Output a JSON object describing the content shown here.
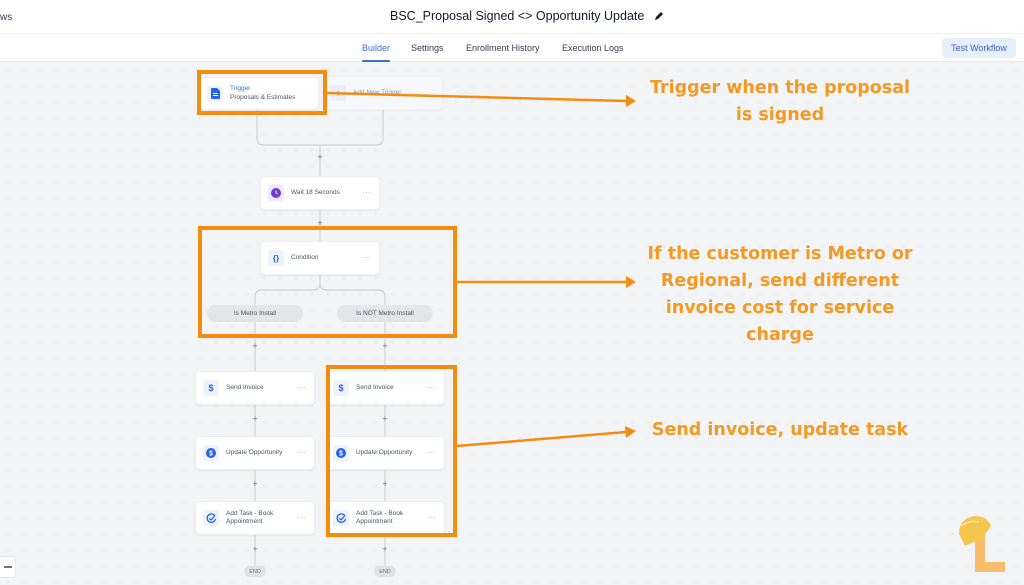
{
  "header": {
    "back_label": "ws",
    "title": "BSC_Proposal Signed <> Opportunity Update",
    "edit_icon": "pencil-icon"
  },
  "tabs": [
    {
      "label": "Builder",
      "active": true
    },
    {
      "label": "Settings",
      "active": false
    },
    {
      "label": "Enrollment History",
      "active": false
    },
    {
      "label": "Execution Logs",
      "active": false
    }
  ],
  "test_button": "Test Workflow",
  "workflow": {
    "trigger": {
      "title": "Trigger",
      "subtitle": "Proposals & Estimates",
      "icon": "document-icon"
    },
    "add_trigger": {
      "label": "Add New Trigger",
      "icon": "plus-icon"
    },
    "wait": {
      "label": "Wait 18 Seconds",
      "icon": "clock-icon"
    },
    "condition": {
      "label": "Condition",
      "icon": "braces-icon"
    },
    "branches": [
      {
        "label": "Is Metro Install",
        "steps": [
          {
            "label": "Send Invoice",
            "icon": "dollar-icon"
          },
          {
            "label": "Update Opportunity",
            "icon": "dollar-circle-icon"
          },
          {
            "label": "Add Task - Book Appointment",
            "icon": "task-check-icon"
          }
        ],
        "end": "END"
      },
      {
        "label": "Is NOT Metro Install",
        "steps": [
          {
            "label": "Send Invoice",
            "icon": "dollar-icon"
          },
          {
            "label": "Update Opportunity",
            "icon": "dollar-circle-icon"
          },
          {
            "label": "Add Task - Book Appointment",
            "icon": "task-check-icon"
          }
        ],
        "end": "END"
      }
    ],
    "more_label": "···",
    "plus_label": "+"
  },
  "annotations": [
    {
      "text": "Trigger when the proposal is signed"
    },
    {
      "text": "If the customer is Metro or Regional, send different invoice cost for service charge"
    },
    {
      "text": "Send invoice, update task"
    }
  ],
  "colors": {
    "accent": "#3b6fd4",
    "annotation": "#f48c0f",
    "annotation_text": "#f39a25"
  }
}
